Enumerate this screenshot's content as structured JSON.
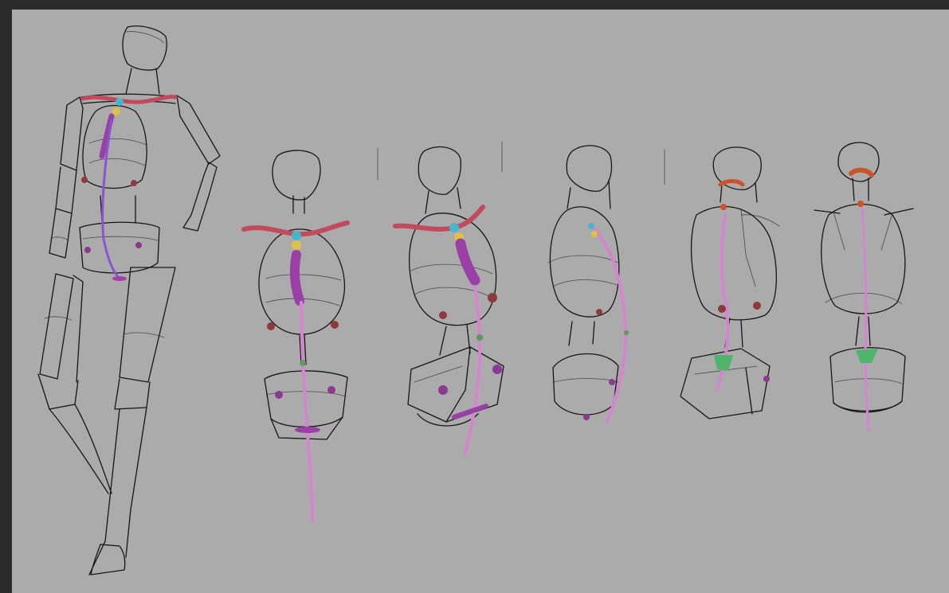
{
  "window": {
    "background": "#2b2b2b"
  },
  "canvas": {
    "background": "#ababab",
    "content": "gesture-anatomy-sketches"
  },
  "colors": {
    "ink": "#161616",
    "clavicle": "#c24a5c",
    "sternal-notch": "#46b6cf",
    "jugular": "#e0c046",
    "sternum": "#9a3fa6",
    "spine": "#d585d0",
    "joint-rib": "#8e3a3a",
    "joint-pelvis": "#8b3a8e",
    "neck-collar": "#c9542c",
    "sacrum": "#4fb46c",
    "green-dot": "#5f9a5a"
  },
  "figures": [
    "full-body-back-view",
    "torso-front-view",
    "torso-three-quarter-front",
    "torso-side-view",
    "torso-three-quarter-back",
    "torso-back-view"
  ]
}
